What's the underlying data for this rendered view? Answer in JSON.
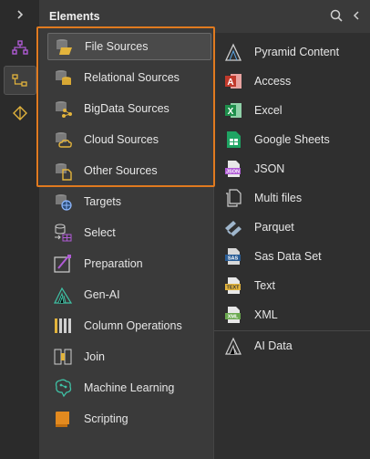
{
  "panel": {
    "title": "Elements"
  },
  "left_items": [
    {
      "label": "File Sources",
      "icon": "file-sources-icon"
    },
    {
      "label": "Relational Sources",
      "icon": "relational-sources-icon"
    },
    {
      "label": "BigData Sources",
      "icon": "bigdata-sources-icon"
    },
    {
      "label": "Cloud Sources",
      "icon": "cloud-sources-icon"
    },
    {
      "label": "Other Sources",
      "icon": "other-sources-icon"
    },
    {
      "label": "Targets",
      "icon": "targets-icon"
    },
    {
      "label": "Select",
      "icon": "select-icon"
    },
    {
      "label": "Preparation",
      "icon": "preparation-icon"
    },
    {
      "label": "Gen-AI",
      "icon": "gen-ai-icon"
    },
    {
      "label": "Column Operations",
      "icon": "column-operations-icon"
    },
    {
      "label": "Join",
      "icon": "join-icon"
    },
    {
      "label": "Machine Learning",
      "icon": "machine-learning-icon"
    },
    {
      "label": "Scripting",
      "icon": "scripting-icon"
    }
  ],
  "right_items": [
    {
      "label": "Pyramid Content",
      "icon": "pyramid-content-icon"
    },
    {
      "label": "Access",
      "icon": "access-icon",
      "color": "#c0392b"
    },
    {
      "label": "Excel",
      "icon": "excel-icon",
      "color": "#1e8e4b"
    },
    {
      "label": "Google Sheets",
      "icon": "google-sheets-icon",
      "color": "#1fa463"
    },
    {
      "label": "JSON",
      "icon": "json-icon"
    },
    {
      "label": "Multi files",
      "icon": "multi-files-icon"
    },
    {
      "label": "Parquet",
      "icon": "parquet-icon"
    },
    {
      "label": "Sas Data Set",
      "icon": "sas-data-set-icon"
    },
    {
      "label": "Text",
      "icon": "text-file-icon"
    },
    {
      "label": "XML",
      "icon": "xml-icon"
    },
    {
      "label": "AI Data",
      "icon": "ai-data-icon"
    }
  ],
  "colors": {
    "highlight": "#e07a1f",
    "accent_purple": "#b05bd6",
    "accent_yellow": "#e3b43c"
  }
}
